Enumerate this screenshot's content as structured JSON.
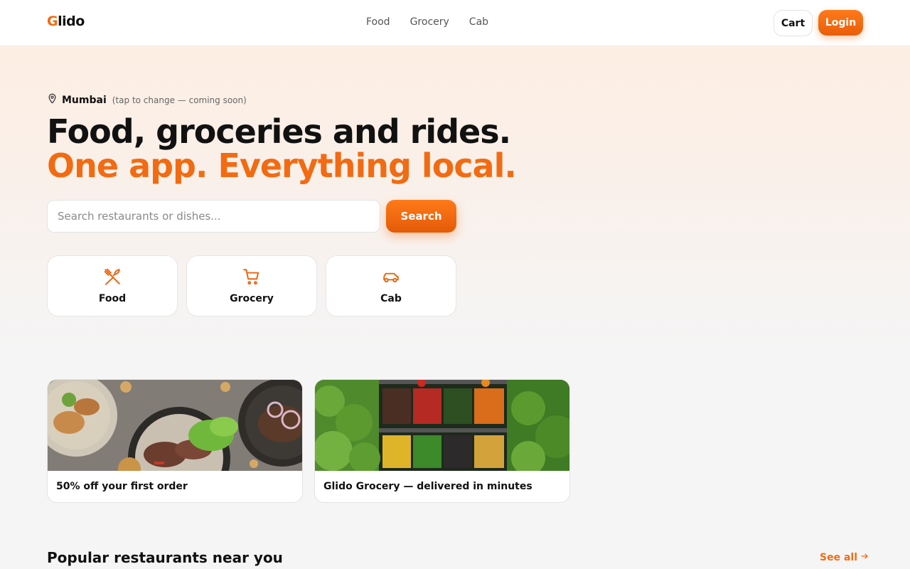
{
  "brand": {
    "logo_first": "G",
    "logo_rest": "lido",
    "accent": "#f26b12"
  },
  "nav": {
    "items": [
      "Food",
      "Grocery",
      "Cab"
    ]
  },
  "header_actions": {
    "cart_label": "Cart",
    "login_label": "Login"
  },
  "location": {
    "city": "Mumbai",
    "hint": "(tap to change — coming soon)",
    "icon": "map-pin-icon"
  },
  "hero": {
    "line1": "Food, groceries and rides.",
    "line2": "One app. Everything local."
  },
  "search": {
    "placeholder": "Search restaurants or dishes...",
    "button_label": "Search"
  },
  "categories": [
    {
      "label": "Food",
      "icon": "fork-knife-icon"
    },
    {
      "label": "Grocery",
      "icon": "cart-icon"
    },
    {
      "label": "Cab",
      "icon": "car-icon"
    }
  ],
  "promos": [
    {
      "caption": "50% off your first order",
      "image": "food-plates-photo"
    },
    {
      "caption": "Glido Grocery — delivered in minutes",
      "image": "vegetable-shelf-photo"
    }
  ],
  "popular": {
    "title": "Popular restaurants near you",
    "see_all_label": "See all"
  }
}
